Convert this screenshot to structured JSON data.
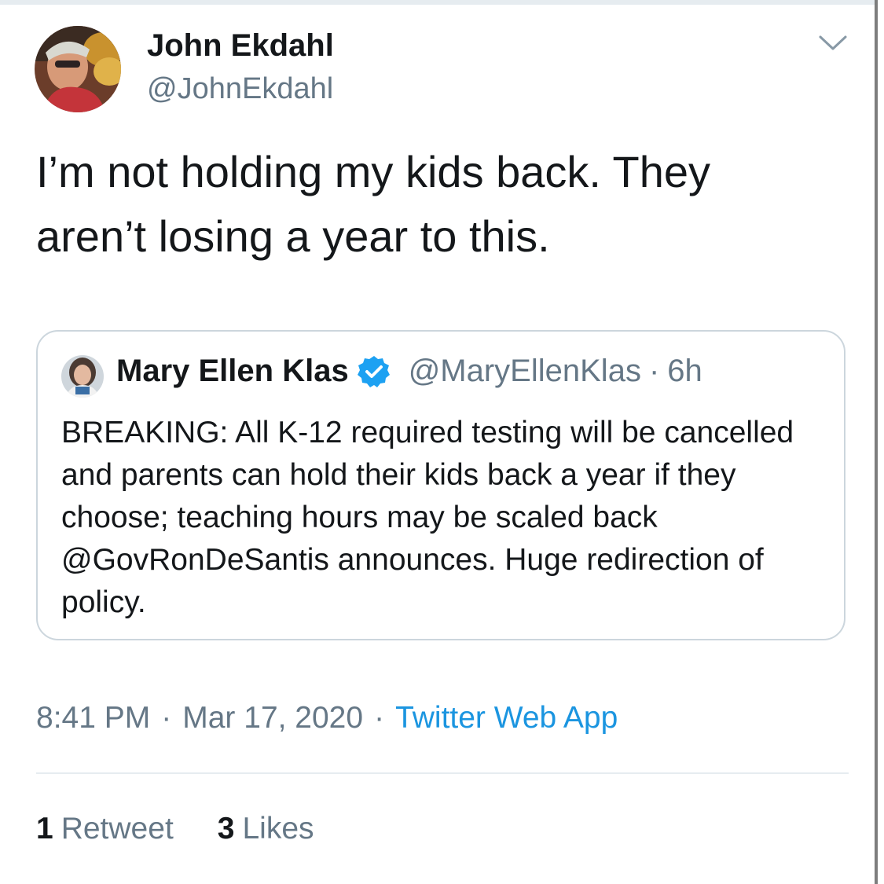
{
  "tweet": {
    "author": {
      "name": "John Ekdahl",
      "handle": "@JohnEkdahl",
      "avatar_icon": "profile-photo"
    },
    "text": "I’m not holding my kids back. They aren’t losing a year to this.",
    "quoted": {
      "author_name": "Mary Ellen Klas",
      "verified": true,
      "author_handle": "@MaryEllenKlas",
      "separator": "·",
      "time": "6h",
      "text": "BREAKING: All K-12 required testing will be cancelled and parents can hold their kids back a year if they choose; teaching hours may be scaled back @GovRonDeSantis announces. Huge redirection of policy."
    },
    "meta": {
      "time": "8:41 PM",
      "separator": "·",
      "date": "Mar 17, 2020",
      "source": "Twitter Web App"
    },
    "stats": {
      "retweets_count": "1",
      "retweets_label": "Retweet",
      "likes_count": "3",
      "likes_label": "Likes"
    }
  },
  "colors": {
    "text": "#14171a",
    "secondary": "#657786",
    "link": "#1b95e0",
    "border": "#ccd6dd",
    "divider": "#e6ecf0",
    "verified": "#1da1f2"
  }
}
